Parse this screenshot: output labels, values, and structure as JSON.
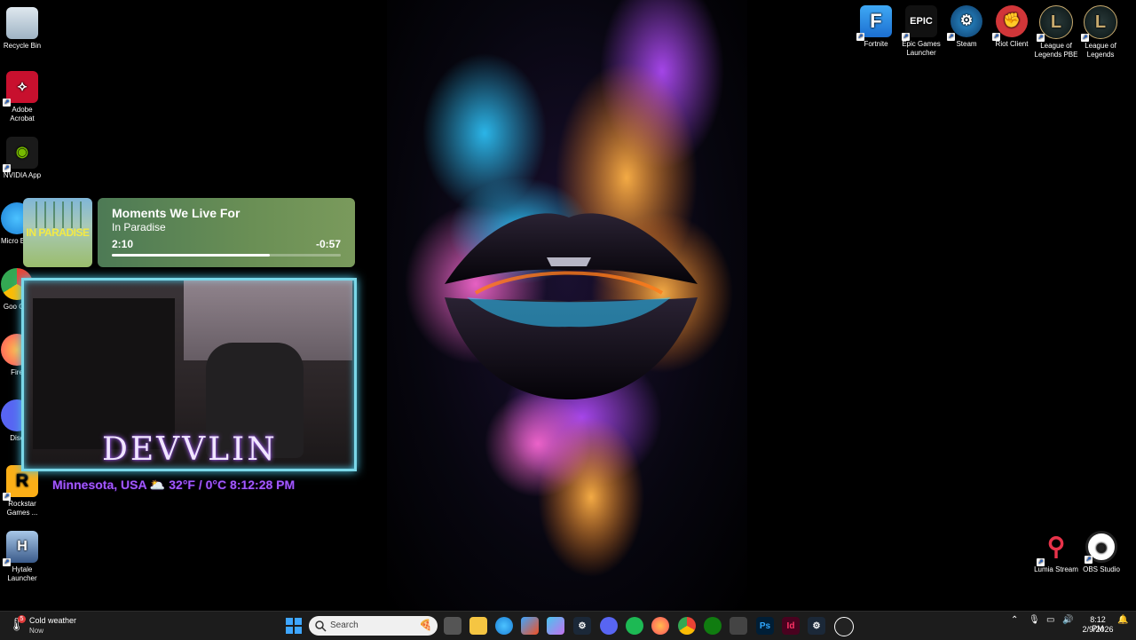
{
  "desktop_left": [
    {
      "label": "Recycle Bin",
      "icon": "recycle-bin-icon"
    },
    {
      "label": "Adobe Acrobat",
      "icon": "acrobat-icon"
    },
    {
      "label": "NVIDIA App",
      "icon": "nvidia-icon"
    },
    {
      "label": "Micro Edg",
      "icon": "edge-icon"
    },
    {
      "label": "Goo Chr",
      "icon": "chrome-icon"
    },
    {
      "label": "Fire",
      "icon": "firefox-icon"
    },
    {
      "label": "Disc",
      "icon": "discord-icon"
    },
    {
      "label": "Rockstar Games ...",
      "icon": "rockstar-icon"
    },
    {
      "label": "Hytale Launcher",
      "icon": "hytale-icon"
    }
  ],
  "desktop_right": [
    {
      "label": "Fortnite",
      "icon": "fortnite-icon",
      "glyph": "F"
    },
    {
      "label": "Epic Games Launcher",
      "icon": "epic-games-icon",
      "glyph": "EPIC"
    },
    {
      "label": "Steam",
      "icon": "steam-icon"
    },
    {
      "label": "Riot Client",
      "icon": "riot-client-icon"
    },
    {
      "label": "League of Legends PBE",
      "icon": "league-pbe-icon",
      "glyph": "L"
    },
    {
      "label": "League of Legends",
      "icon": "league-icon",
      "glyph": "L"
    }
  ],
  "desktop_bottom_right": [
    {
      "label": "Lumia Stream",
      "icon": "lumia-stream-icon"
    },
    {
      "label": "OBS Studio",
      "icon": "obs-studio-icon"
    }
  ],
  "music": {
    "album_art_text": "IN PARADISE",
    "title": "Moments We Live For",
    "artist": "In Paradise",
    "elapsed": "2:10",
    "remaining": "-0:57",
    "progress": 0.69
  },
  "stream_overlay": {
    "name": "DEVVLIN",
    "info": "Minnesota, USA 🌥️ 32°F / 0°C 8:12:28 PM"
  },
  "taskbar": {
    "weather_title": "Cold weather",
    "weather_sub": "Now",
    "weather_badge": "5",
    "search_placeholder": "Search",
    "apps": [
      "windows-start",
      "task-view",
      "file-explorer",
      "edge",
      "store",
      "copilot",
      "steam",
      "discord",
      "spotify",
      "firefox",
      "chrome",
      "xbox",
      "snipping-tool",
      "photoshop",
      "indesign",
      "steam-2",
      "obs"
    ],
    "clock_time": "8:12 PM",
    "clock_date": "2/9/2026"
  },
  "colors": {
    "cam_border": "#7ad7e8",
    "overlay_text": "#a259ff",
    "taskbar_bg": "#1c1c1c"
  }
}
